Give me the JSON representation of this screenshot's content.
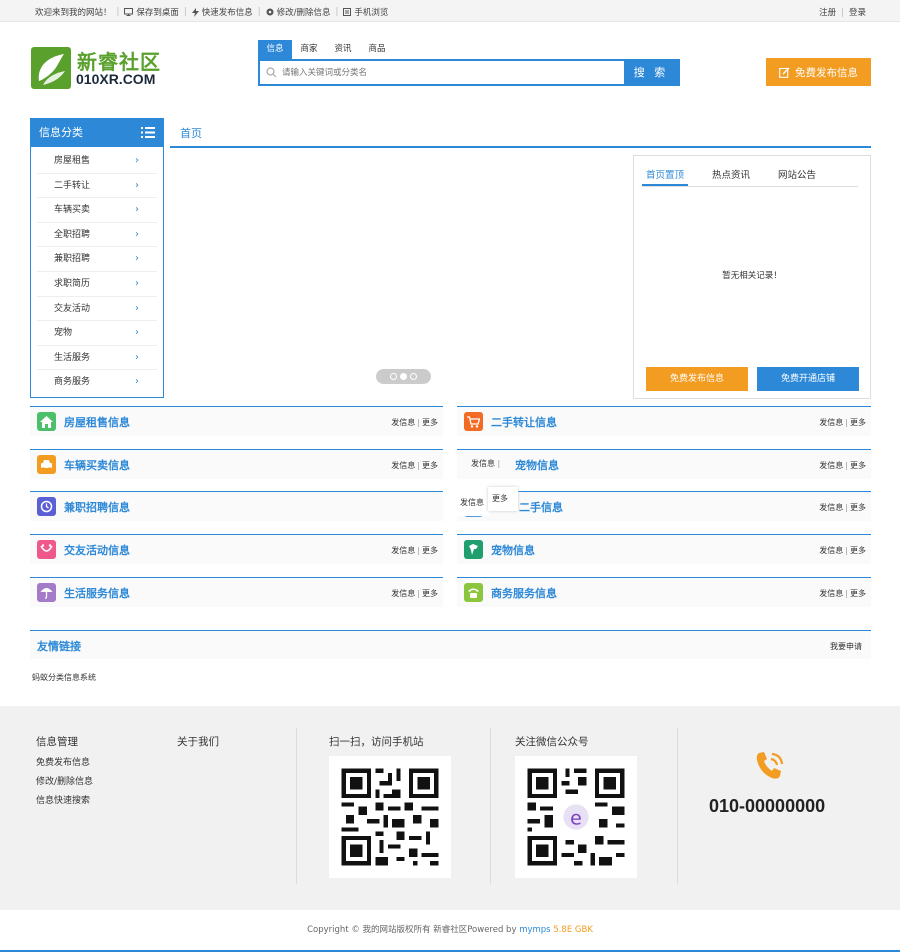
{
  "topbar": {
    "welcome": "欢迎来到我的网站！",
    "save_desktop": "保存到桌面",
    "quick_post": "快速发布信息",
    "edit_delete": "修改/删除信息",
    "mobile_browse": "手机浏览",
    "register": "注册",
    "login": "登录"
  },
  "logo": {
    "cn": "新睿社区",
    "en": "010XR.COM"
  },
  "search": {
    "tabs": [
      "信息",
      "商家",
      "资讯",
      "商品"
    ],
    "placeholder": "请输入关键词或分类名",
    "button": "搜 索"
  },
  "publish_button": "免费发布信息",
  "categories": {
    "title": "信息分类",
    "items": [
      "房屋租售",
      "二手转让",
      "车辆买卖",
      "全职招聘",
      "兼职招聘",
      "求职简历",
      "交友活动",
      "宠物",
      "生活服务",
      "商务服务"
    ]
  },
  "nav": {
    "home": "首页"
  },
  "notice": {
    "tabs": [
      "首页置顶",
      "热点资讯",
      "网站公告"
    ],
    "empty": "暂无相关记录！",
    "btn_post": "免费发布信息",
    "btn_shop": "免费开通店铺"
  },
  "sections": {
    "post": "发信息",
    "more": "更多",
    "left": [
      "房屋租售信息",
      "车辆买卖信息",
      "兼职招聘信息",
      "交友活动信息",
      "生活服务信息"
    ],
    "right": [
      "二手转让信息",
      "宠物信息",
      "二手信息",
      "宠物信息",
      "商务服务信息"
    ]
  },
  "links": {
    "title": "友情链接",
    "apply": "我要申请",
    "item": "蚂蚁分类信息系统"
  },
  "footer": {
    "manage_title": "信息管理",
    "manage_items": [
      "免费发布信息",
      "修改/删除信息",
      "信息快速搜索"
    ],
    "about_title": "关于我们",
    "mobile_title": "扫一扫，访问手机站",
    "wechat_title": "关注微信公众号",
    "phone": "010-00000000"
  },
  "copyright": {
    "text": "Copyright © 我的网站版权所有 新睿社区Powered by ",
    "brand": "mymps",
    "version": "5.8E GBK"
  },
  "colors": {
    "primary": "#2d89d8",
    "orange": "#f39c22",
    "green": "#5aa02c"
  }
}
